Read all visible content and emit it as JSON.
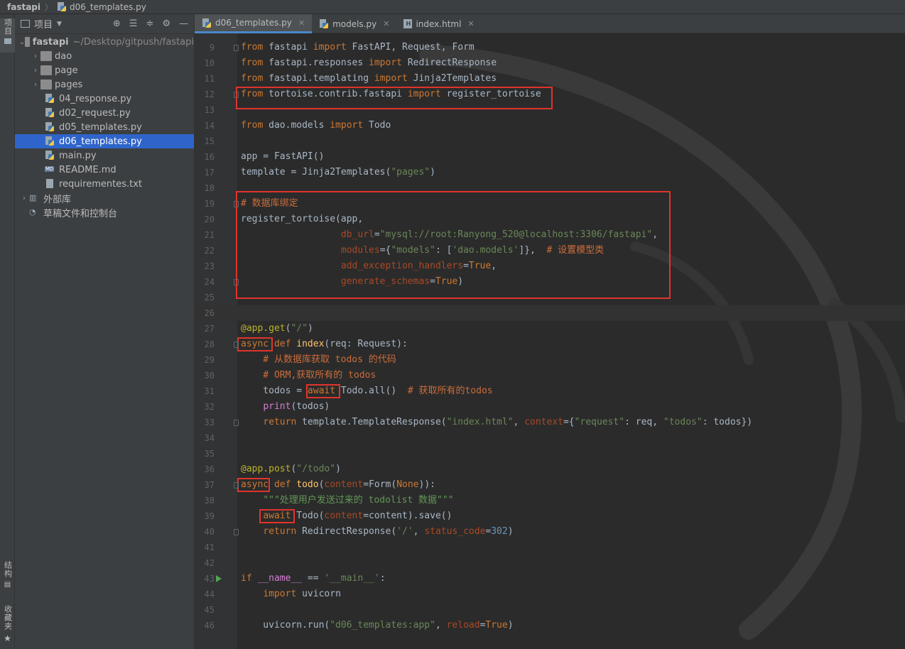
{
  "breadcrumb": {
    "root": "fastapi",
    "file": "d06_templates.py"
  },
  "left_strip": {
    "project_tab": "项目",
    "structure_tab": "结构",
    "favorites_tab": "收藏夹"
  },
  "project_panel": {
    "title": "项目",
    "tree": [
      {
        "label": "fastapi",
        "path": "~/Desktop/gitpush/fastapi",
        "type": "root",
        "expanded": true
      },
      {
        "label": "dao",
        "type": "folder"
      },
      {
        "label": "page",
        "type": "folder"
      },
      {
        "label": "pages",
        "type": "folder"
      },
      {
        "label": "04_response.py",
        "type": "py"
      },
      {
        "label": "d02_request.py",
        "type": "py"
      },
      {
        "label": "d05_templates.py",
        "type": "py"
      },
      {
        "label": "d06_templates.py",
        "type": "py",
        "selected": true
      },
      {
        "label": "main.py",
        "type": "py"
      },
      {
        "label": "README.md",
        "type": "md"
      },
      {
        "label": "requirementes.txt",
        "type": "txt"
      },
      {
        "label": "外部库",
        "type": "lib"
      },
      {
        "label": "草稿文件和控制台",
        "type": "scratch"
      }
    ]
  },
  "tabs": [
    {
      "label": "d06_templates.py",
      "active": true
    },
    {
      "label": "models.py",
      "active": false
    },
    {
      "label": "index.html",
      "active": false
    }
  ],
  "editor": {
    "current_line": 26,
    "lines": [
      {
        "n": "9",
        "code": "from fastapi import FastAPI, Request, Form"
      },
      {
        "n": "10",
        "code": "from fastapi.responses import RedirectResponse"
      },
      {
        "n": "11",
        "code": "from fastapi.templating import Jinja2Templates"
      },
      {
        "n": "12",
        "code": "from tortoise.contrib.fastapi import register_tortoise"
      },
      {
        "n": "13",
        "code": ""
      },
      {
        "n": "14",
        "code": "from dao.models import Todo"
      },
      {
        "n": "15",
        "code": ""
      },
      {
        "n": "16",
        "code": "app = FastAPI()"
      },
      {
        "n": "17",
        "code": "template = Jinja2Templates(\"pages\")"
      },
      {
        "n": "18",
        "code": ""
      },
      {
        "n": "19",
        "code": "# 数据库绑定"
      },
      {
        "n": "20",
        "code": "register_tortoise(app,"
      },
      {
        "n": "21",
        "code": "                  db_url=\"mysql://root:Ranyong_520@localhost:3306/fastapi\","
      },
      {
        "n": "22",
        "code": "                  modules={\"models\": ['dao.models']},  # 设置模型类"
      },
      {
        "n": "23",
        "code": "                  add_exception_handlers=True,"
      },
      {
        "n": "24",
        "code": "                  generate_schemas=True)"
      },
      {
        "n": "25",
        "code": ""
      },
      {
        "n": "26",
        "code": ""
      },
      {
        "n": "27",
        "code": "@app.get(\"/\")"
      },
      {
        "n": "28",
        "code": "async def index(req: Request):"
      },
      {
        "n": "29",
        "code": "    # 从数据库获取 todos 的代码"
      },
      {
        "n": "30",
        "code": "    # ORM,获取所有的 todos"
      },
      {
        "n": "31",
        "code": "    todos = await Todo.all()  # 获取所有的todos"
      },
      {
        "n": "32",
        "code": "    print(todos)"
      },
      {
        "n": "33",
        "code": "    return template.TemplateResponse(\"index.html\", context={\"request\": req, \"todos\": todos})"
      },
      {
        "n": "34",
        "code": ""
      },
      {
        "n": "35",
        "code": ""
      },
      {
        "n": "36",
        "code": "@app.post(\"/todo\")"
      },
      {
        "n": "37",
        "code": "async def todo(content=Form(None)):"
      },
      {
        "n": "38",
        "code": "    \"\"\"处理用户发送过来的 todolist 数据\"\"\""
      },
      {
        "n": "39",
        "code": "    await Todo(content=content).save()"
      },
      {
        "n": "40",
        "code": "    return RedirectResponse('/', status_code=302)"
      },
      {
        "n": "41",
        "code": ""
      },
      {
        "n": "42",
        "code": ""
      },
      {
        "n": "43",
        "code": "if __name__ == '__main__':"
      },
      {
        "n": "44",
        "code": "    import uvicorn"
      },
      {
        "n": "45",
        "code": ""
      },
      {
        "n": "46",
        "code": "    uvicorn.run(\"d06_templates:app\", reload=True)"
      }
    ]
  },
  "colors": {
    "highlight_box": "#e0342c",
    "selection": "#2f65ca",
    "keyword": "#cc7832",
    "string": "#6a8759"
  }
}
